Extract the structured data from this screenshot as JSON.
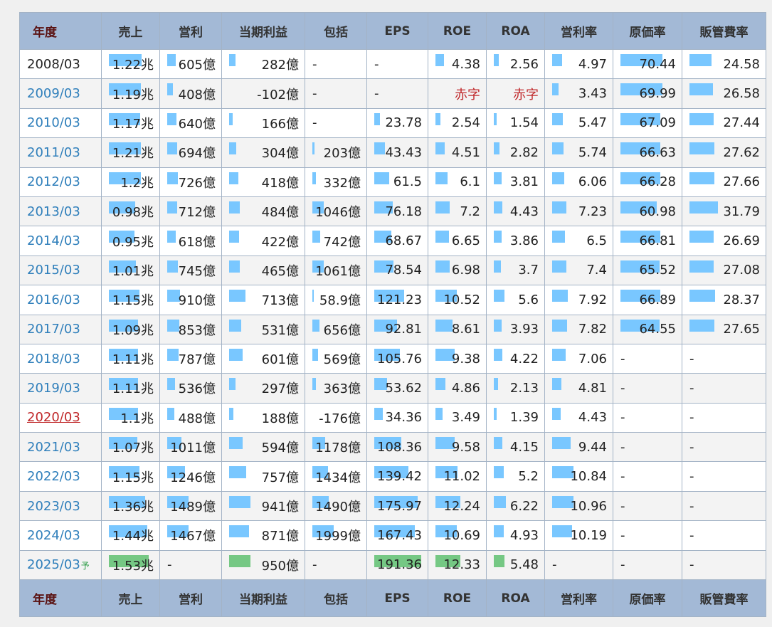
{
  "headers": [
    "年度",
    "売上",
    "営利",
    "当期利益",
    "包括",
    "EPS",
    "ROE",
    "ROA",
    "営利率",
    "原価率",
    "販管費率"
  ],
  "rows": [
    {
      "year": "2008/03",
      "year_style": "plain",
      "forecast": false,
      "cells": [
        {
          "text": "1.22兆",
          "bar": 0.82
        },
        {
          "text": "605億",
          "bar": 0.4
        },
        {
          "text": "282億",
          "bar": 0.3
        },
        {
          "text": "-",
          "dash": true
        },
        {
          "text": "-",
          "dash": true
        },
        {
          "text": "4.38",
          "bar": 0.35
        },
        {
          "text": "2.56",
          "bar": 0.2
        },
        {
          "text": "4.97",
          "bar": 0.45
        },
        {
          "text": "70.44",
          "bar": 0.99
        },
        {
          "text": "24.58",
          "bar": 0.77
        }
      ]
    },
    {
      "year": "2009/03",
      "year_style": "link",
      "forecast": false,
      "cells": [
        {
          "text": "1.19兆",
          "bar": 0.8
        },
        {
          "text": "408億",
          "bar": 0.27
        },
        {
          "text": "-102億",
          "bar": 0
        },
        {
          "text": "-",
          "dash": true
        },
        {
          "text": "-",
          "dash": true
        },
        {
          "text": "赤字",
          "red": true
        },
        {
          "text": "赤字",
          "red": true
        },
        {
          "text": "3.43",
          "bar": 0.31
        },
        {
          "text": "69.99",
          "bar": 0.98
        },
        {
          "text": "26.58",
          "bar": 0.83
        }
      ]
    },
    {
      "year": "2010/03",
      "year_style": "link",
      "forecast": false,
      "cells": [
        {
          "text": "1.17兆",
          "bar": 0.78
        },
        {
          "text": "640億",
          "bar": 0.43
        },
        {
          "text": "166億",
          "bar": 0.17
        },
        {
          "text": "-",
          "dash": true
        },
        {
          "text": "23.78",
          "bar": 0.12
        },
        {
          "text": "2.54",
          "bar": 0.2
        },
        {
          "text": "1.54",
          "bar": 0.12
        },
        {
          "text": "5.47",
          "bar": 0.5
        },
        {
          "text": "67.09",
          "bar": 0.94
        },
        {
          "text": "27.44",
          "bar": 0.86
        }
      ]
    },
    {
      "year": "2011/03",
      "year_style": "link",
      "forecast": false,
      "cells": [
        {
          "text": "1.21兆",
          "bar": 0.81
        },
        {
          "text": "694億",
          "bar": 0.47
        },
        {
          "text": "304億",
          "bar": 0.32
        },
        {
          "text": "203億",
          "bar": 0.1
        },
        {
          "text": "43.43",
          "bar": 0.23
        },
        {
          "text": "4.51",
          "bar": 0.36
        },
        {
          "text": "2.82",
          "bar": 0.22
        },
        {
          "text": "5.74",
          "bar": 0.52
        },
        {
          "text": "66.63",
          "bar": 0.93
        },
        {
          "text": "27.62",
          "bar": 0.87
        }
      ]
    },
    {
      "year": "2012/03",
      "year_style": "link",
      "forecast": false,
      "cells": [
        {
          "text": "1.2兆",
          "bar": 0.8
        },
        {
          "text": "726億",
          "bar": 0.49
        },
        {
          "text": "418億",
          "bar": 0.44
        },
        {
          "text": "332億",
          "bar": 0.17
        },
        {
          "text": "61.5",
          "bar": 0.32
        },
        {
          "text": "6.1",
          "bar": 0.49
        },
        {
          "text": "3.81",
          "bar": 0.3
        },
        {
          "text": "6.06",
          "bar": 0.55
        },
        {
          "text": "66.28",
          "bar": 0.93
        },
        {
          "text": "27.66",
          "bar": 0.87
        }
      ]
    },
    {
      "year": "2013/03",
      "year_style": "link",
      "forecast": false,
      "cells": [
        {
          "text": "0.98兆",
          "bar": 0.66
        },
        {
          "text": "712億",
          "bar": 0.48
        },
        {
          "text": "484億",
          "bar": 0.51
        },
        {
          "text": "1046億",
          "bar": 0.52
        },
        {
          "text": "76.18",
          "bar": 0.4
        },
        {
          "text": "7.2",
          "bar": 0.58
        },
        {
          "text": "4.43",
          "bar": 0.35
        },
        {
          "text": "7.23",
          "bar": 0.66
        },
        {
          "text": "60.98",
          "bar": 0.85
        },
        {
          "text": "31.79",
          "bar": 1.0
        }
      ]
    },
    {
      "year": "2014/03",
      "year_style": "link",
      "forecast": false,
      "cells": [
        {
          "text": "0.95兆",
          "bar": 0.64
        },
        {
          "text": "618億",
          "bar": 0.41
        },
        {
          "text": "422億",
          "bar": 0.45
        },
        {
          "text": "742億",
          "bar": 0.37
        },
        {
          "text": "68.67",
          "bar": 0.36
        },
        {
          "text": "6.65",
          "bar": 0.53
        },
        {
          "text": "3.86",
          "bar": 0.3
        },
        {
          "text": "6.5",
          "bar": 0.59
        },
        {
          "text": "66.81",
          "bar": 0.94
        },
        {
          "text": "26.69",
          "bar": 0.84
        }
      ]
    },
    {
      "year": "2015/03",
      "year_style": "link",
      "forecast": false,
      "cells": [
        {
          "text": "1.01兆",
          "bar": 0.68
        },
        {
          "text": "745億",
          "bar": 0.5
        },
        {
          "text": "465億",
          "bar": 0.49
        },
        {
          "text": "1061億",
          "bar": 0.53
        },
        {
          "text": "78.54",
          "bar": 0.41
        },
        {
          "text": "6.98",
          "bar": 0.56
        },
        {
          "text": "3.7",
          "bar": 0.29
        },
        {
          "text": "7.4",
          "bar": 0.68
        },
        {
          "text": "65.52",
          "bar": 0.92
        },
        {
          "text": "27.08",
          "bar": 0.85
        }
      ]
    },
    {
      "year": "2016/03",
      "year_style": "link",
      "forecast": false,
      "cells": [
        {
          "text": "1.15兆",
          "bar": 0.77
        },
        {
          "text": "910億",
          "bar": 0.61,
          "asterisk": true
        },
        {
          "text": "713億",
          "bar": 0.75
        },
        {
          "text": "58.9億",
          "bar": 0.03
        },
        {
          "text": "121.23",
          "bar": 0.63
        },
        {
          "text": "10.52",
          "bar": 0.85
        },
        {
          "text": "5.6",
          "bar": 0.44
        },
        {
          "text": "7.92",
          "bar": 0.72
        },
        {
          "text": "66.89",
          "bar": 0.94
        },
        {
          "text": "28.37",
          "bar": 0.89
        }
      ]
    },
    {
      "year": "2017/03",
      "year_style": "link",
      "forecast": false,
      "cells": [
        {
          "text": "1.09兆",
          "bar": 0.73
        },
        {
          "text": "853億",
          "bar": 0.57,
          "asterisk": true
        },
        {
          "text": "531億",
          "bar": 0.56
        },
        {
          "text": "656億",
          "bar": 0.33
        },
        {
          "text": "92.81",
          "bar": 0.49
        },
        {
          "text": "8.61",
          "bar": 0.69
        },
        {
          "text": "3.93",
          "bar": 0.31
        },
        {
          "text": "7.82",
          "bar": 0.71
        },
        {
          "text": "64.55",
          "bar": 0.91
        },
        {
          "text": "27.65",
          "bar": 0.87
        }
      ]
    },
    {
      "year": "2018/03",
      "year_style": "link",
      "forecast": false,
      "cells": [
        {
          "text": "1.11兆",
          "bar": 0.74
        },
        {
          "text": "787億",
          "bar": 0.53
        },
        {
          "text": "601億",
          "bar": 0.64
        },
        {
          "text": "569億",
          "bar": 0.28
        },
        {
          "text": "105.76",
          "bar": 0.55
        },
        {
          "text": "9.38",
          "bar": 0.76
        },
        {
          "text": "4.22",
          "bar": 0.33
        },
        {
          "text": "7.06",
          "bar": 0.64
        },
        {
          "text": "-",
          "dash": true
        },
        {
          "text": "-",
          "dash": true
        }
      ]
    },
    {
      "year": "2019/03",
      "year_style": "link",
      "forecast": false,
      "cells": [
        {
          "text": "1.11兆",
          "bar": 0.74
        },
        {
          "text": "536億",
          "bar": 0.36
        },
        {
          "text": "297億",
          "bar": 0.31
        },
        {
          "text": "363億",
          "bar": 0.18
        },
        {
          "text": "53.62",
          "bar": 0.28
        },
        {
          "text": "4.86",
          "bar": 0.39
        },
        {
          "text": "2.13",
          "bar": 0.17
        },
        {
          "text": "4.81",
          "bar": 0.44
        },
        {
          "text": "-",
          "dash": true
        },
        {
          "text": "-",
          "dash": true
        }
      ]
    },
    {
      "year": "2020/03",
      "year_style": "red",
      "forecast": false,
      "cells": [
        {
          "text": "1.1兆",
          "bar": 0.74
        },
        {
          "text": "488億",
          "bar": 0.33
        },
        {
          "text": "188億",
          "bar": 0.2
        },
        {
          "text": "-176億",
          "bar": 0
        },
        {
          "text": "34.36",
          "bar": 0.18
        },
        {
          "text": "3.49",
          "bar": 0.28
        },
        {
          "text": "1.39",
          "bar": 0.11
        },
        {
          "text": "4.43",
          "bar": 0.4
        },
        {
          "text": "-",
          "dash": true
        },
        {
          "text": "-",
          "dash": true
        }
      ]
    },
    {
      "year": "2021/03",
      "year_style": "link",
      "forecast": false,
      "cells": [
        {
          "text": "1.07兆",
          "bar": 0.72
        },
        {
          "text": "1011億",
          "bar": 0.68
        },
        {
          "text": "594億",
          "bar": 0.63
        },
        {
          "text": "1178億",
          "bar": 0.59
        },
        {
          "text": "108.36",
          "bar": 0.57
        },
        {
          "text": "9.58",
          "bar": 0.77
        },
        {
          "text": "4.15",
          "bar": 0.33
        },
        {
          "text": "9.44",
          "bar": 0.86
        },
        {
          "text": "-",
          "dash": true
        },
        {
          "text": "-",
          "dash": true
        }
      ]
    },
    {
      "year": "2022/03",
      "year_style": "link",
      "forecast": false,
      "cells": [
        {
          "text": "1.15兆",
          "bar": 0.77
        },
        {
          "text": "1246億",
          "bar": 0.84
        },
        {
          "text": "757億",
          "bar": 0.8
        },
        {
          "text": "1434億",
          "bar": 0.72
        },
        {
          "text": "139.42",
          "bar": 0.73
        },
        {
          "text": "11.02",
          "bar": 0.89
        },
        {
          "text": "5.2",
          "bar": 0.41
        },
        {
          "text": "10.84",
          "bar": 0.99
        },
        {
          "text": "-",
          "dash": true
        },
        {
          "text": "-",
          "dash": true
        }
      ]
    },
    {
      "year": "2023/03",
      "year_style": "link",
      "forecast": false,
      "cells": [
        {
          "text": "1.36兆",
          "bar": 0.91
        },
        {
          "text": "1489億",
          "bar": 1.0
        },
        {
          "text": "941億",
          "bar": 0.99
        },
        {
          "text": "1490億",
          "bar": 0.75
        },
        {
          "text": "175.97",
          "bar": 0.92
        },
        {
          "text": "12.24",
          "bar": 0.99
        },
        {
          "text": "6.22",
          "bar": 0.49
        },
        {
          "text": "10.96",
          "bar": 1.0
        },
        {
          "text": "-",
          "dash": true
        },
        {
          "text": "-",
          "dash": true
        }
      ]
    },
    {
      "year": "2024/03",
      "year_style": "link",
      "forecast": false,
      "cells": [
        {
          "text": "1.44兆",
          "bar": 0.97
        },
        {
          "text": "1467億",
          "bar": 0.99
        },
        {
          "text": "871億",
          "bar": 0.92
        },
        {
          "text": "1999億",
          "bar": 1.0
        },
        {
          "text": "167.43",
          "bar": 0.87
        },
        {
          "text": "10.69",
          "bar": 0.86
        },
        {
          "text": "4.93",
          "bar": 0.39
        },
        {
          "text": "10.19",
          "bar": 0.93
        },
        {
          "text": "-",
          "dash": true
        },
        {
          "text": "-",
          "dash": true
        }
      ]
    },
    {
      "year": "2025/03",
      "year_style": "link",
      "forecast": true,
      "forecast_mark": "予",
      "cells": [
        {
          "text": "1.53兆",
          "bar": 1.0
        },
        {
          "text": "-",
          "dash": true
        },
        {
          "text": "950億",
          "bar": 1.0
        },
        {
          "text": "-",
          "dash": true
        },
        {
          "text": "191.36",
          "bar": 1.0
        },
        {
          "text": "12.33",
          "bar": 1.0
        },
        {
          "text": "5.48",
          "bar": 0.43
        },
        {
          "text": "-",
          "dash": true
        },
        {
          "text": "-",
          "dash": true
        },
        {
          "text": "-",
          "dash": true
        }
      ]
    }
  ],
  "colors": {
    "bar_actual": "#79c7ff",
    "bar_forecast": "#75c884",
    "header_bg": "#a3b9d6",
    "year_link": "#2f7fbb",
    "year_red": "#c0282a"
  }
}
